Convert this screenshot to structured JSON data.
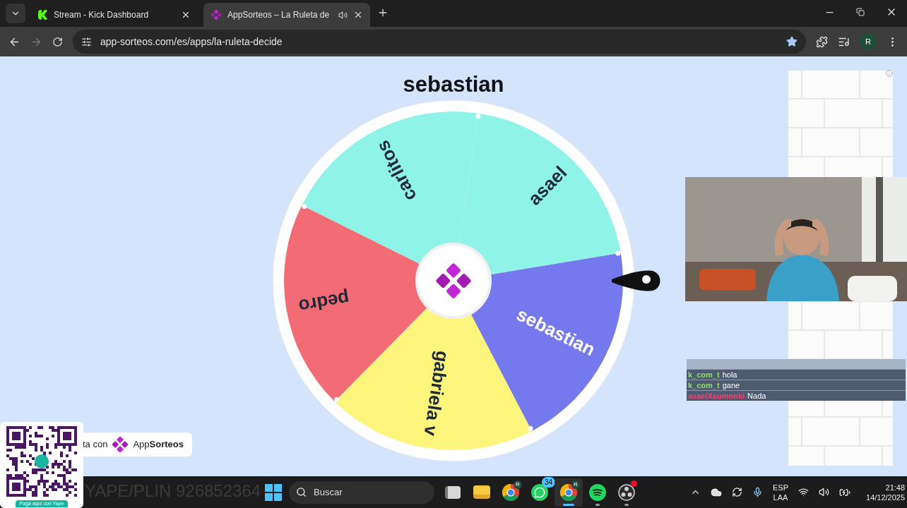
{
  "browser": {
    "tabs": [
      {
        "title": "Stream - Kick Dashboard",
        "kind": "kick",
        "selected": false,
        "audio": false
      },
      {
        "title": "AppSorteos – La Ruleta de",
        "kind": "appsorteos",
        "selected": true,
        "audio": true
      }
    ],
    "url": "app-sorteos.com/es/apps/la-ruleta-decide",
    "bookmarked": true,
    "profile_initial": "R"
  },
  "wheel": {
    "winner": "sebastian",
    "segments": [
      {
        "label": "carlitos",
        "color": "#8ff3e7"
      },
      {
        "label": "asael",
        "color": "#8ff3e7"
      },
      {
        "label": "sebastian",
        "color": "#7479ee"
      },
      {
        "label": "gabriela v",
        "color": "#fdf57c"
      },
      {
        "label": "pedro",
        "color": "#f36b74"
      }
    ]
  },
  "credit": {
    "text": "ta con",
    "brand": "App**Sorteos**"
  },
  "chat": {
    "messages": [
      {
        "user": "k_com_t",
        "message": "hola",
        "color": "#8ee06a"
      },
      {
        "user": "k_com_t",
        "message": "gane",
        "color": "#8ee06a"
      },
      {
        "user": "asaelXsumonki",
        "message": "Nada",
        "color": "#ff3d6e"
      }
    ]
  },
  "donation": {
    "qr_caption": "Paga aquí con Yape",
    "text": "YAPE/PLIN 926852364"
  },
  "taskbar": {
    "search_label": "Buscar",
    "apps": [
      {
        "kind": "task-view",
        "active": false,
        "running": false
      },
      {
        "kind": "folder",
        "active": false,
        "running": false
      },
      {
        "kind": "chrome",
        "profile": "R",
        "active": false,
        "running": false
      },
      {
        "kind": "whatsapp",
        "badge": "34",
        "active": false,
        "running": false
      },
      {
        "kind": "chrome",
        "profile": "R",
        "active": true,
        "running": true
      },
      {
        "kind": "spotify",
        "active": false,
        "running": true
      },
      {
        "kind": "obs",
        "active": false,
        "running": true,
        "alert": true
      }
    ],
    "language": [
      "ESP",
      "LAA"
    ],
    "time": "21:48",
    "date": "14/12/2025"
  }
}
